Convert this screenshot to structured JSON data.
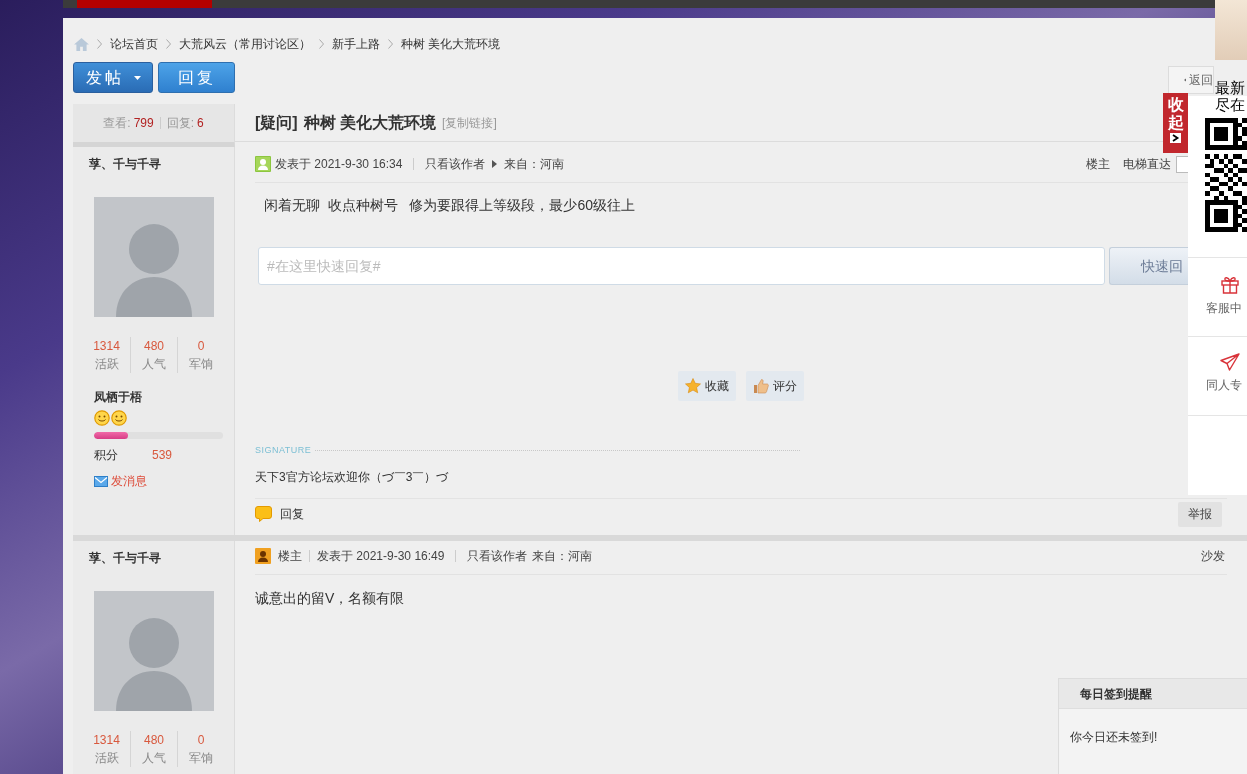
{
  "breadcrumb": {
    "items": [
      "论坛首页",
      "大荒风云（常用讨论区）",
      "新手上路",
      "种树 美化大荒环境"
    ]
  },
  "toolbar": {
    "buttons": [
      {
        "label": "发帖",
        "kind": "dropdown"
      },
      {
        "label": "回复",
        "kind": "plain"
      }
    ],
    "back_link": "返回"
  },
  "thread": {
    "views_label": "查看:",
    "views": "799",
    "replies_label": "回复:",
    "replies": "6",
    "tag": "[疑问]",
    "title": "种树 美化大荒环境",
    "copy_link": "[复制链接]"
  },
  "posts": [
    {
      "kind": "first",
      "author": {
        "name": "莩、千与千寻",
        "stats": [
          {
            "value": "1314",
            "label": "活跃"
          },
          {
            "value": "480",
            "label": "人气"
          },
          {
            "value": "0",
            "label": "军饷"
          }
        ],
        "group": "凤栖于梧",
        "level": 0.26,
        "points_label": "积分",
        "points": "539",
        "message_link": "发消息"
      },
      "meta": {
        "posted": "发表于 2021-9-30 16:34",
        "author_only": "只看该作者",
        "source": "来自：河南"
      },
      "floor": "楼主",
      "jump_label": "电梯直达",
      "content": "闲着无聊  收点种树号   修为要跟得上等级段，最少60级往上",
      "quick_reply": {
        "placeholder": "#在这里快速回复#",
        "button": "快速回"
      },
      "actions": [
        {
          "label": "收藏",
          "kind": "favorite"
        },
        {
          "label": "评分",
          "kind": "rate"
        }
      ],
      "signature": {
        "label": "SIGNATURE",
        "text": "天下3官方论坛欢迎你（づ￣3￣）づ"
      },
      "footer": {
        "reply": "回复",
        "report": "举报"
      }
    },
    {
      "kind": "reply",
      "author": {
        "name": "莩、千与千寻",
        "stats": [
          {
            "value": "1314",
            "label": "活跃"
          },
          {
            "value": "480",
            "label": "人气"
          },
          {
            "value": "0",
            "label": "军饷"
          }
        ]
      },
      "meta": {
        "badge": "楼主",
        "posted": "发表于 2021-9-30 16:49",
        "author_only": "只看该作者",
        "source": "来自：河南"
      },
      "floor": "沙发",
      "content": "诚意出的留V，名额有限"
    }
  ],
  "side_panel": {
    "caption": [
      "最新",
      "尽在"
    ],
    "collapse_label": "收起",
    "links": [
      {
        "label": "客服中",
        "kind": "gift"
      },
      {
        "label": "同人专",
        "kind": "send"
      }
    ]
  },
  "checkin": {
    "title": "每日签到提醒",
    "message": "你今日还未签到!"
  }
}
